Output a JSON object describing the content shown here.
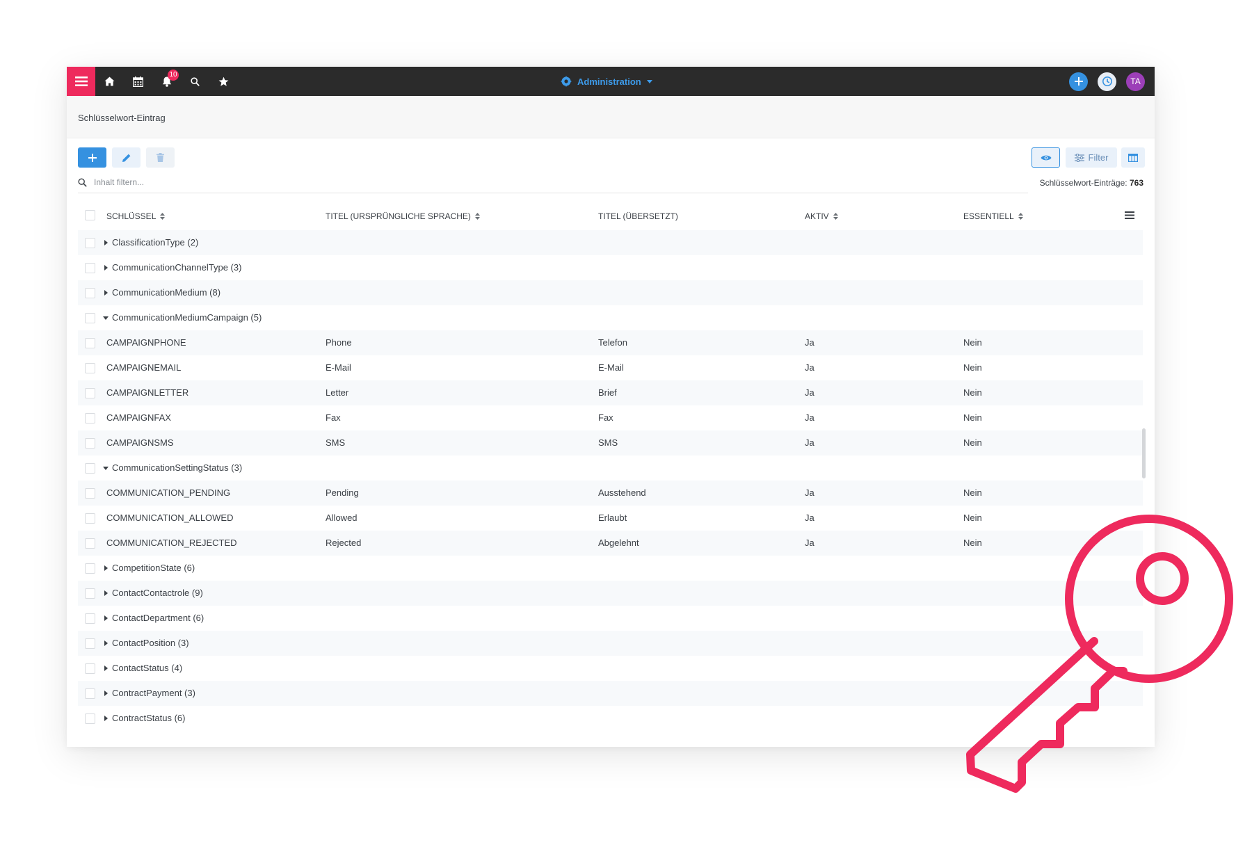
{
  "topbar": {
    "notification_count": "10",
    "app_name": "Administration",
    "avatar_initials": "TA"
  },
  "breadcrumb": "Schlüsselwort-Eintrag",
  "search": {
    "placeholder": "Inhalt filtern..."
  },
  "toolbar": {
    "filter_label": "Filter"
  },
  "entry_count": {
    "label": "Schlüsselwort-Einträge:",
    "value": "763"
  },
  "columns": {
    "key": "SCHLÜSSEL",
    "title_original": "TITEL (URSPRÜNGLICHE SPRACHE)",
    "title_translated": "TITEL (ÜBERSETZT)",
    "active": "AKTIV",
    "essential": "ESSENTIELL"
  },
  "rows": [
    {
      "type": "group",
      "label": "ClassificationType (2)",
      "expanded": false
    },
    {
      "type": "group",
      "label": "CommunicationChannelType (3)",
      "expanded": false
    },
    {
      "type": "group",
      "label": "CommunicationMedium (8)",
      "expanded": false
    },
    {
      "type": "group",
      "label": "CommunicationMediumCampaign (5)",
      "expanded": true
    },
    {
      "type": "item",
      "key": "CAMPAIGNPHONE",
      "orig": "Phone",
      "trans": "Telefon",
      "active": "Ja",
      "essential": "Nein"
    },
    {
      "type": "item",
      "key": "CAMPAIGNEMAIL",
      "orig": "E-Mail",
      "trans": "E-Mail",
      "active": "Ja",
      "essential": "Nein"
    },
    {
      "type": "item",
      "key": "CAMPAIGNLETTER",
      "orig": "Letter",
      "trans": "Brief",
      "active": "Ja",
      "essential": "Nein"
    },
    {
      "type": "item",
      "key": "CAMPAIGNFAX",
      "orig": "Fax",
      "trans": "Fax",
      "active": "Ja",
      "essential": "Nein"
    },
    {
      "type": "item",
      "key": "CAMPAIGNSMS",
      "orig": "SMS",
      "trans": "SMS",
      "active": "Ja",
      "essential": "Nein"
    },
    {
      "type": "group",
      "label": "CommunicationSettingStatus (3)",
      "expanded": true
    },
    {
      "type": "item",
      "key": "COMMUNICATION_PENDING",
      "orig": "Pending",
      "trans": "Ausstehend",
      "active": "Ja",
      "essential": "Nein"
    },
    {
      "type": "item",
      "key": "COMMUNICATION_ALLOWED",
      "orig": "Allowed",
      "trans": "Erlaubt",
      "active": "Ja",
      "essential": "Nein"
    },
    {
      "type": "item",
      "key": "COMMUNICATION_REJECTED",
      "orig": "Rejected",
      "trans": "Abgelehnt",
      "active": "Ja",
      "essential": "Nein"
    },
    {
      "type": "group",
      "label": "CompetitionState (6)",
      "expanded": false
    },
    {
      "type": "group",
      "label": "ContactContactrole (9)",
      "expanded": false
    },
    {
      "type": "group",
      "label": "ContactDepartment (6)",
      "expanded": false
    },
    {
      "type": "group",
      "label": "ContactPosition (3)",
      "expanded": false
    },
    {
      "type": "group",
      "label": "ContactStatus (4)",
      "expanded": false
    },
    {
      "type": "group",
      "label": "ContractPayment (3)",
      "expanded": false
    },
    {
      "type": "group",
      "label": "ContractStatus (6)",
      "expanded": false
    }
  ],
  "colors": {
    "brand": "#ee2a5d",
    "accent": "#3591e0",
    "topbar": "#2b2b2b"
  }
}
